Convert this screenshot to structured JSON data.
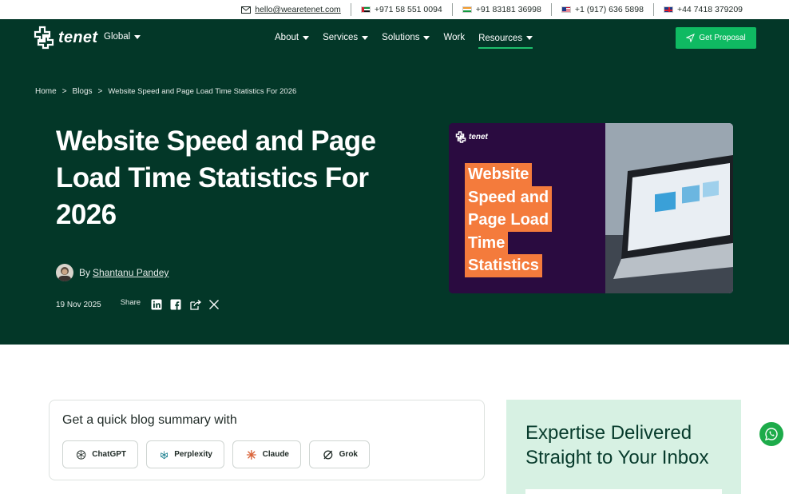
{
  "topbar": {
    "email": "hello@wearetenet.com",
    "phones": [
      "+971 58 551 0094",
      "+91 83181 36998",
      "+1 (917) 636 5898",
      "+44 7418 379209"
    ]
  },
  "nav": {
    "brand": "tenet",
    "region": "Global",
    "menu": [
      "About",
      "Services",
      "Solutions",
      "Work",
      "Resources"
    ],
    "cta": "Get Proposal"
  },
  "breadcrumb": [
    "Home",
    ">",
    "Blogs",
    ">",
    "Website Speed and Page Load Time Statistics For 2026"
  ],
  "article": {
    "title": "Website Speed and Page Load Time Statistics For 2026",
    "by": "By",
    "author": "Shantanu Pandey",
    "date": "19 Nov 2025",
    "share": "Share"
  },
  "feature_image": {
    "brand": "tenet",
    "lines": [
      "Website",
      "Speed and",
      "Page Load",
      "Time",
      "Statistics"
    ]
  },
  "summary": {
    "heading": "Get a quick blog summary with",
    "buttons": [
      "ChatGPT",
      "Perplexity",
      "Claude",
      "Grok"
    ]
  },
  "newsletter": {
    "heading": "Expertise Delivered Straight to Your Inbox"
  },
  "colors": {
    "hero_bg": "#033728",
    "cta": "#0fba62",
    "accent_orange": "#f47b3c",
    "newsletter_bg": "#d7f1e3"
  }
}
